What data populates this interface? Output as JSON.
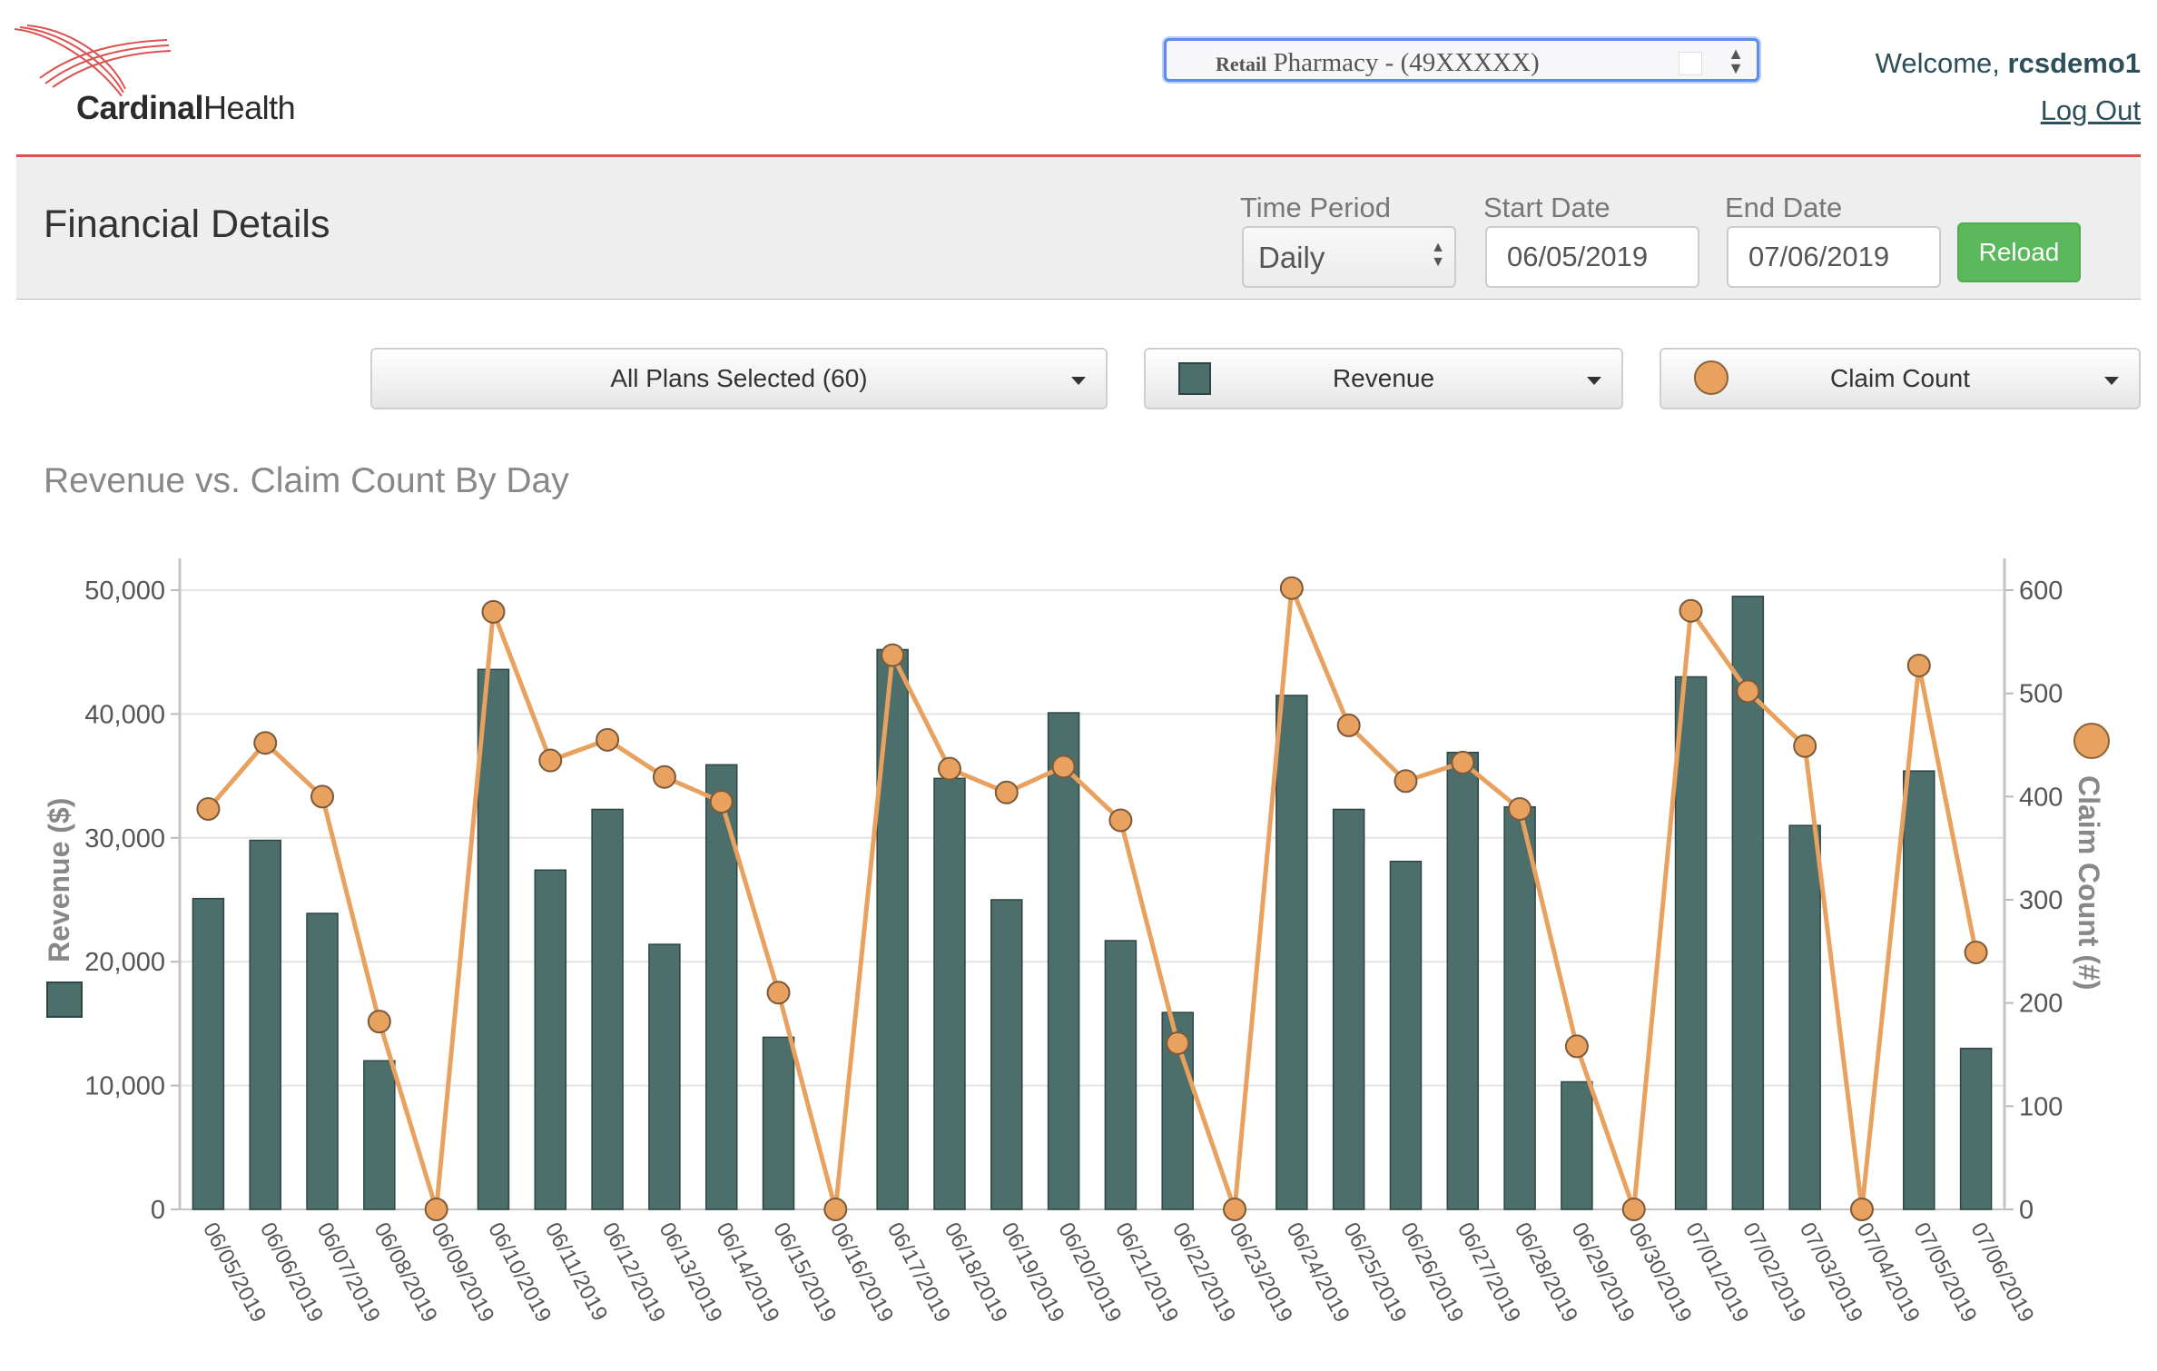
{
  "header": {
    "logo_bold": "Cardinal",
    "logo_light": "Health",
    "account_select_small": "Retail",
    "account_select_rest": "Pharmacy - (49XXXXX)",
    "welcome_prefix": "Welcome,",
    "welcome_user": "rcsdemo1",
    "logout_label": "Log Out",
    "colors": {
      "rule": "#d9534f",
      "link": "#2d4f5a"
    }
  },
  "filters": {
    "page_title": "Financial Details",
    "time_period_label": "Time Period",
    "time_period_value": "Daily",
    "start_date_label": "Start Date",
    "start_date_value": "06/05/2019",
    "end_date_label": "End Date",
    "end_date_value": "07/06/2019",
    "reload_label": "Reload"
  },
  "selectors": {
    "plans_label": "All Plans Selected (60)",
    "bar_metric_label": "Revenue",
    "line_metric_label": "Claim Count"
  },
  "chart_title": "Revenue vs. Claim Count By Day",
  "chart_data": {
    "type": "bar",
    "categories": [
      "06/05/2019",
      "06/06/2019",
      "06/07/2019",
      "06/08/2019",
      "06/09/2019",
      "06/10/2019",
      "06/11/2019",
      "06/12/2019",
      "06/13/2019",
      "06/14/2019",
      "06/15/2019",
      "06/16/2019",
      "06/17/2019",
      "06/18/2019",
      "06/19/2019",
      "06/20/2019",
      "06/21/2019",
      "06/22/2019",
      "06/23/2019",
      "06/24/2019",
      "06/25/2019",
      "06/26/2019",
      "06/27/2019",
      "06/28/2019",
      "06/29/2019",
      "06/30/2019",
      "07/01/2019",
      "07/02/2019",
      "07/03/2019",
      "07/04/2019",
      "07/05/2019",
      "07/06/2019"
    ],
    "series": [
      {
        "name": "Revenue",
        "type": "bar",
        "axis": "left",
        "color": "#4d6f6c",
        "values": [
          25100,
          29800,
          23900,
          12000,
          0,
          43600,
          27400,
          32300,
          21400,
          35900,
          13900,
          0,
          45200,
          34800,
          25000,
          40100,
          21700,
          15900,
          0,
          41500,
          32300,
          28100,
          36900,
          32500,
          10300,
          0,
          43000,
          49500,
          31000,
          0,
          35400,
          13000
        ]
      },
      {
        "name": "Claim Count",
        "type": "line",
        "axis": "right",
        "color": "#e8a15e",
        "values": [
          388,
          452,
          400,
          182,
          0,
          579,
          435,
          455,
          419,
          395,
          210,
          0,
          537,
          427,
          404,
          429,
          377,
          161,
          0,
          602,
          469,
          415,
          433,
          388,
          158,
          0,
          580,
          502,
          449,
          0,
          527,
          249
        ]
      }
    ],
    "ylabel": "Revenue ($)",
    "y2label": "Claim Count (#)",
    "ylim": [
      0,
      50000
    ],
    "yticks": [
      "0",
      "10,000",
      "20,000",
      "30,000",
      "40,000",
      "50,000"
    ],
    "y2lim": [
      0,
      600
    ],
    "y2ticks": [
      "0",
      "100",
      "200",
      "300",
      "400",
      "500",
      "600"
    ],
    "grid": true
  }
}
